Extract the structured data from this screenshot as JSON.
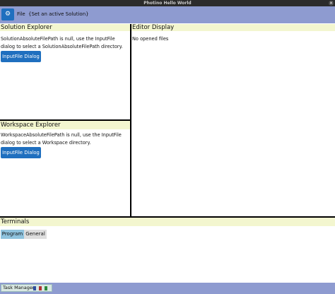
{
  "window": {
    "title": "Photino Hello World",
    "close_glyph": "×"
  },
  "topbar": {
    "settings_icon": "gear-icon",
    "settings_glyph": "⚙",
    "file_label": "File",
    "active_solution_label": "{Set an active Solution}"
  },
  "solution_explorer": {
    "title": "Solution Explorer",
    "message": "SolutionAbsoluteFilePath is null, use the InputFile dialog to select a SolutionAbsoluteFilePath directory.",
    "button_label": "InputFile Dialog"
  },
  "workspace_explorer": {
    "title": "Workspace Explorer",
    "message": "WorkspaceAbsoluteFilePath is null, use the InputFile dialog to select a Workspace directory.",
    "button_label": "InputFile Dialog"
  },
  "editor_display": {
    "title": "Editor Display",
    "message": "No opened files"
  },
  "terminals": {
    "title": "Terminals",
    "tabs": [
      {
        "label": "Program",
        "selected": true
      },
      {
        "label": "General",
        "selected": false
      }
    ]
  },
  "bottombar": {
    "task_manager_label": "Task Manager",
    "status_colors": [
      "#2f4fa0",
      "#b03030",
      "#2e8a3a"
    ]
  },
  "colors": {
    "accent": "#1f6fbf",
    "bar": "#8e9bd0",
    "panel_header": "#f3f6cf"
  }
}
